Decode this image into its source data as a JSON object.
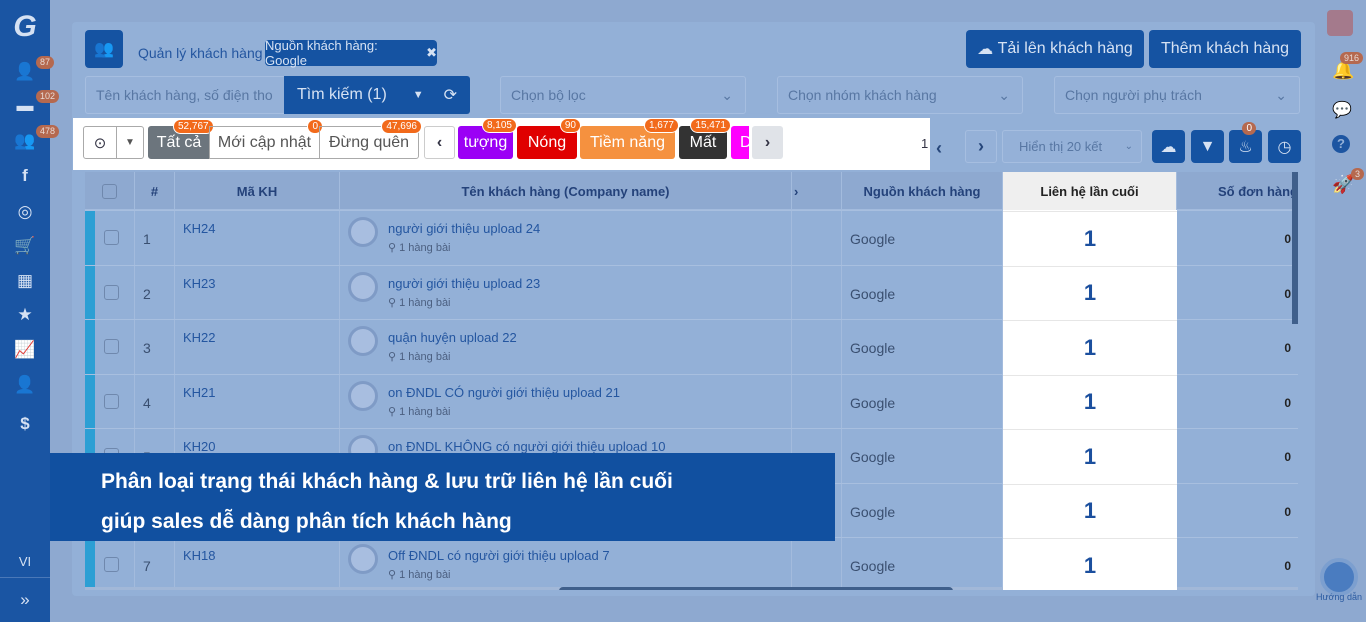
{
  "sidebar": {
    "items": [
      {
        "icon": "logo-icon"
      },
      {
        "icon": "users-icon",
        "badge": "87"
      },
      {
        "icon": "inbox-icon",
        "badge": "102"
      },
      {
        "icon": "users-group-icon",
        "badge": "478"
      },
      {
        "icon": "facebook-icon"
      },
      {
        "icon": "target-icon"
      },
      {
        "icon": "cart-icon"
      },
      {
        "icon": "cubes-icon"
      },
      {
        "icon": "star-icon"
      },
      {
        "icon": "chart-line-icon"
      },
      {
        "icon": "user-tie-icon"
      },
      {
        "icon": "dollar-icon"
      }
    ],
    "language": "VI",
    "expand": "»"
  },
  "header": {
    "breadcrumb": "Quản lý khách hàng",
    "filter_tag": "Nguồn khách hàng: Google",
    "upload_button": "Tải lên khách hàng",
    "add_button": "Thêm khách hàng"
  },
  "search": {
    "placeholder": "Tên khách hàng, số điện tho",
    "search_button": "Tìm kiếm (1)",
    "filter_select": "Chọn bộ lọc",
    "group_select": "Chọn nhóm khách hàng",
    "owner_select": "Chọn người phụ trách"
  },
  "status_tabs": [
    {
      "label": "Tất cả",
      "count": "52,767",
      "color": "#6c757d"
    },
    {
      "label": "Mới cập nhật",
      "count": "0"
    },
    {
      "label": "Đừng quên",
      "count": "47,696"
    },
    {
      "label": "tượng",
      "count": "8,105",
      "color": "#9b00f5"
    },
    {
      "label": "Nóng",
      "count": "90",
      "color": "#e00000"
    },
    {
      "label": "Tiềm năng",
      "count": "1,677",
      "color": "#f5913f"
    },
    {
      "label": "Mất",
      "count": "15,471",
      "color": "#333333"
    },
    {
      "label": "D",
      "color": "#ff00ff"
    }
  ],
  "pagination": {
    "page": "1",
    "page_size": "Hiển thị 20 kết",
    "cake_badge": "0"
  },
  "table": {
    "columns": [
      "#",
      "Mã KH",
      "Tên khách hàng (Company name)",
      "Nguồn khách hàng",
      "Liên hệ lần cuối",
      "Số đơn hàng"
    ],
    "rows": [
      {
        "num": "1",
        "code": "KH24",
        "name": "người giới thiệu upload 24",
        "addr": "1 hàng bài",
        "source": "Google",
        "last_contact": "1",
        "orders": "0"
      },
      {
        "num": "2",
        "code": "KH23",
        "name": "người giới thiệu upload 23",
        "addr": "1 hàng bài",
        "source": "Google",
        "last_contact": "1",
        "orders": "0"
      },
      {
        "num": "3",
        "code": "KH22",
        "name": "quận huyện upload 22",
        "addr": "1 hàng bài",
        "source": "Google",
        "last_contact": "1",
        "orders": "0"
      },
      {
        "num": "4",
        "code": "KH21",
        "name": "on ĐNDL CÓ người giới thiệu upload 21",
        "addr": "1 hàng bài",
        "source": "Google",
        "last_contact": "1",
        "orders": "0"
      },
      {
        "num": "5",
        "code": "KH20",
        "name": "on ĐNDL KHÔNG có người giới thiệu upload 10",
        "addr": "",
        "source": "Google",
        "last_contact": "1",
        "orders": "0"
      },
      {
        "num": "",
        "code": "",
        "name": "",
        "addr": "",
        "source": "Google",
        "last_contact": "1",
        "orders": "0"
      },
      {
        "num": "7",
        "code": "KH18",
        "name": "Off ĐNDL có người giới thiệu upload 7",
        "addr": "1 hàng bài",
        "source": "Google",
        "last_contact": "1",
        "orders": "0"
      }
    ]
  },
  "right_bar": {
    "notification_badge": "916",
    "rocket_badge": "3",
    "guide_label": "Hướng dẫn"
  },
  "banner": {
    "line1": "Phân loại trạng thái khách hàng &  lưu trữ liên hệ lần cuối",
    "line2": "giúp sales  dễ dàng phân tích khách hàng"
  }
}
